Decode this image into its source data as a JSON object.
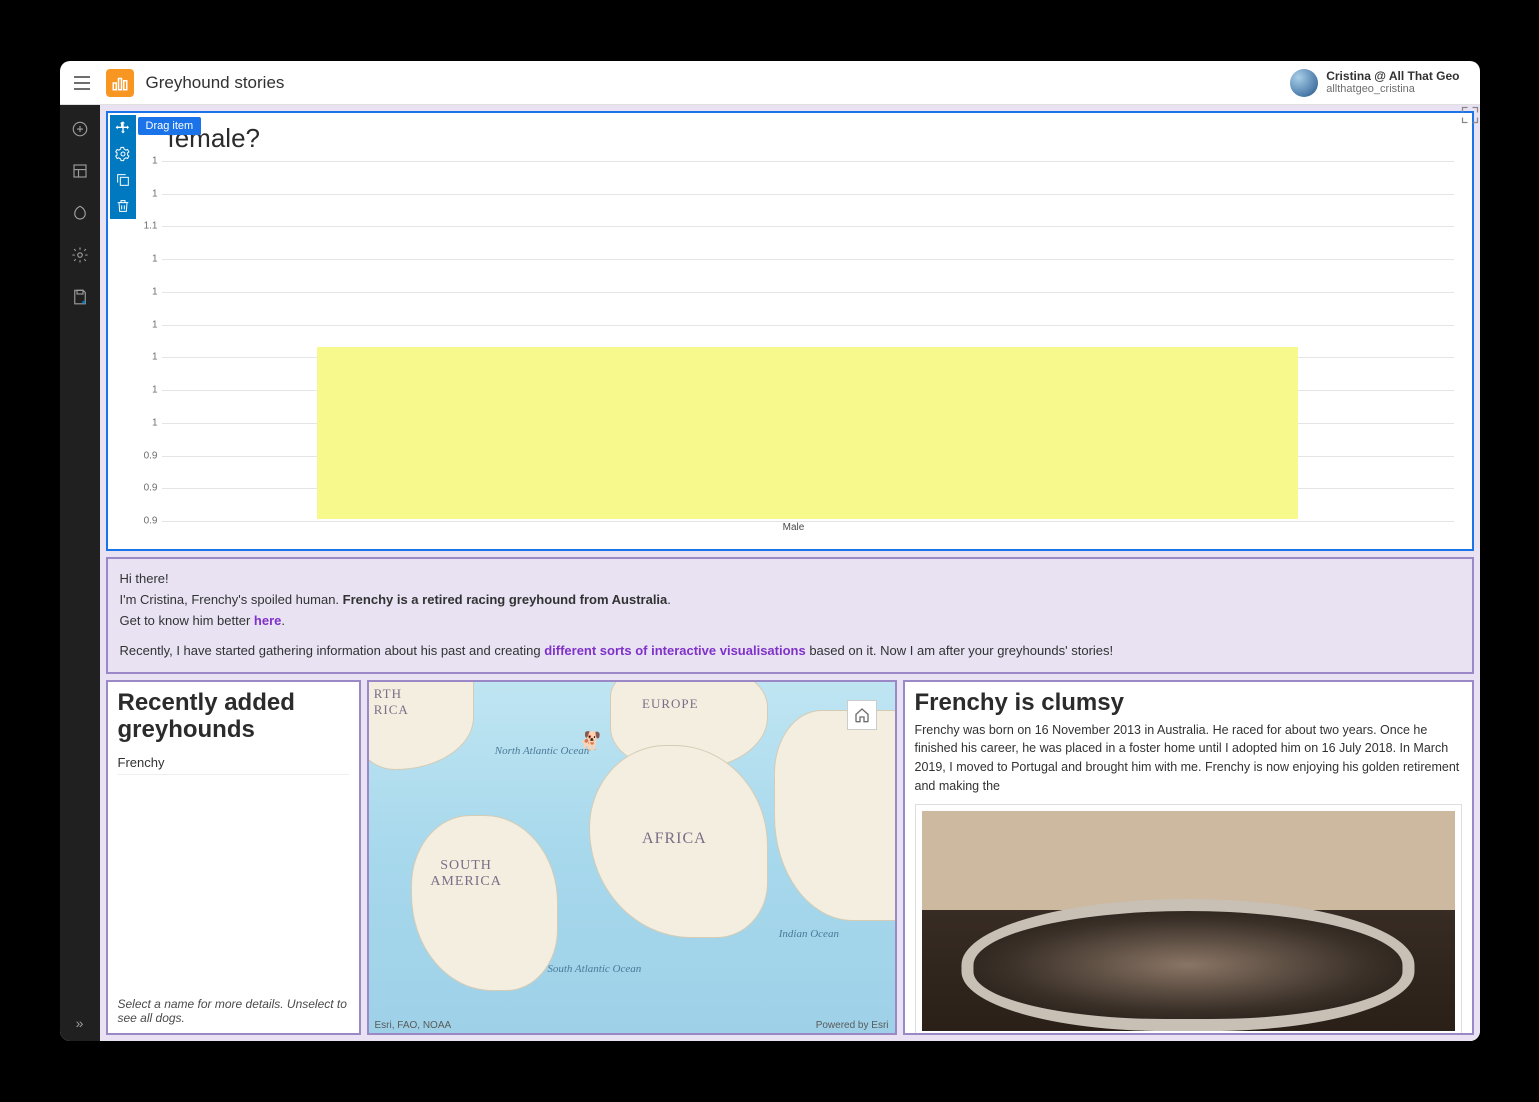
{
  "header": {
    "title": "Greyhound stories",
    "user_name": "Cristina @ All That Geo",
    "user_handle": "allthatgeo_cristina"
  },
  "toolbar": {
    "drag_tooltip": "Drag item"
  },
  "chart_data": {
    "type": "bar",
    "title": "female?",
    "categories": [
      "Male"
    ],
    "values": [
      1
    ],
    "y_ticks": [
      0.9,
      0.9,
      0.9,
      1,
      1,
      1,
      1,
      1,
      1,
      1.1,
      1,
      1
    ],
    "ylim": [
      0.9,
      1.1
    ],
    "xlabel": "Male"
  },
  "intro": {
    "line1_a": "Hi there!",
    "line2_a": "I'm Cristina, Frenchy's spoiled human. ",
    "line2_b": "Frenchy is a retired racing greyhound from Australia",
    "line2_c": ".",
    "line3_a": "Get to know him better ",
    "line3_link": "here",
    "line3_b": ".",
    "line4_a": "Recently, I have started gathering information about his past and creating ",
    "line4_link": "different sorts of interactive visualisations",
    "line4_b": " based on it. Now I am after your greyhounds' stories!"
  },
  "list": {
    "title": "Recently added greyhounds",
    "items": [
      "Frenchy"
    ],
    "hint": "Select a name for more details. Unselect to see all dogs."
  },
  "map": {
    "labels": {
      "europe": "EUROPE",
      "africa": "AFRICA",
      "south_america": "SOUTH AMERICA",
      "north_america_frag": "RTH RICA",
      "north_atlantic": "North Atlantic Ocean",
      "south_atlantic": "South Atlantic Ocean",
      "indian": "Indian Ocean"
    },
    "attribution": "Esri, FAO, NOAA",
    "powered": "Powered by Esri"
  },
  "story": {
    "title": "Frenchy is clumsy",
    "text": "Frenchy was born on 16 November 2013 in Australia. He raced for about two years. Once he finished his career, he was placed in a foster home until I adopted him on 16 July 2018. In March 2019, I moved to Portugal and brought him with me. Frenchy is now enjoying his golden retirement and making the"
  }
}
